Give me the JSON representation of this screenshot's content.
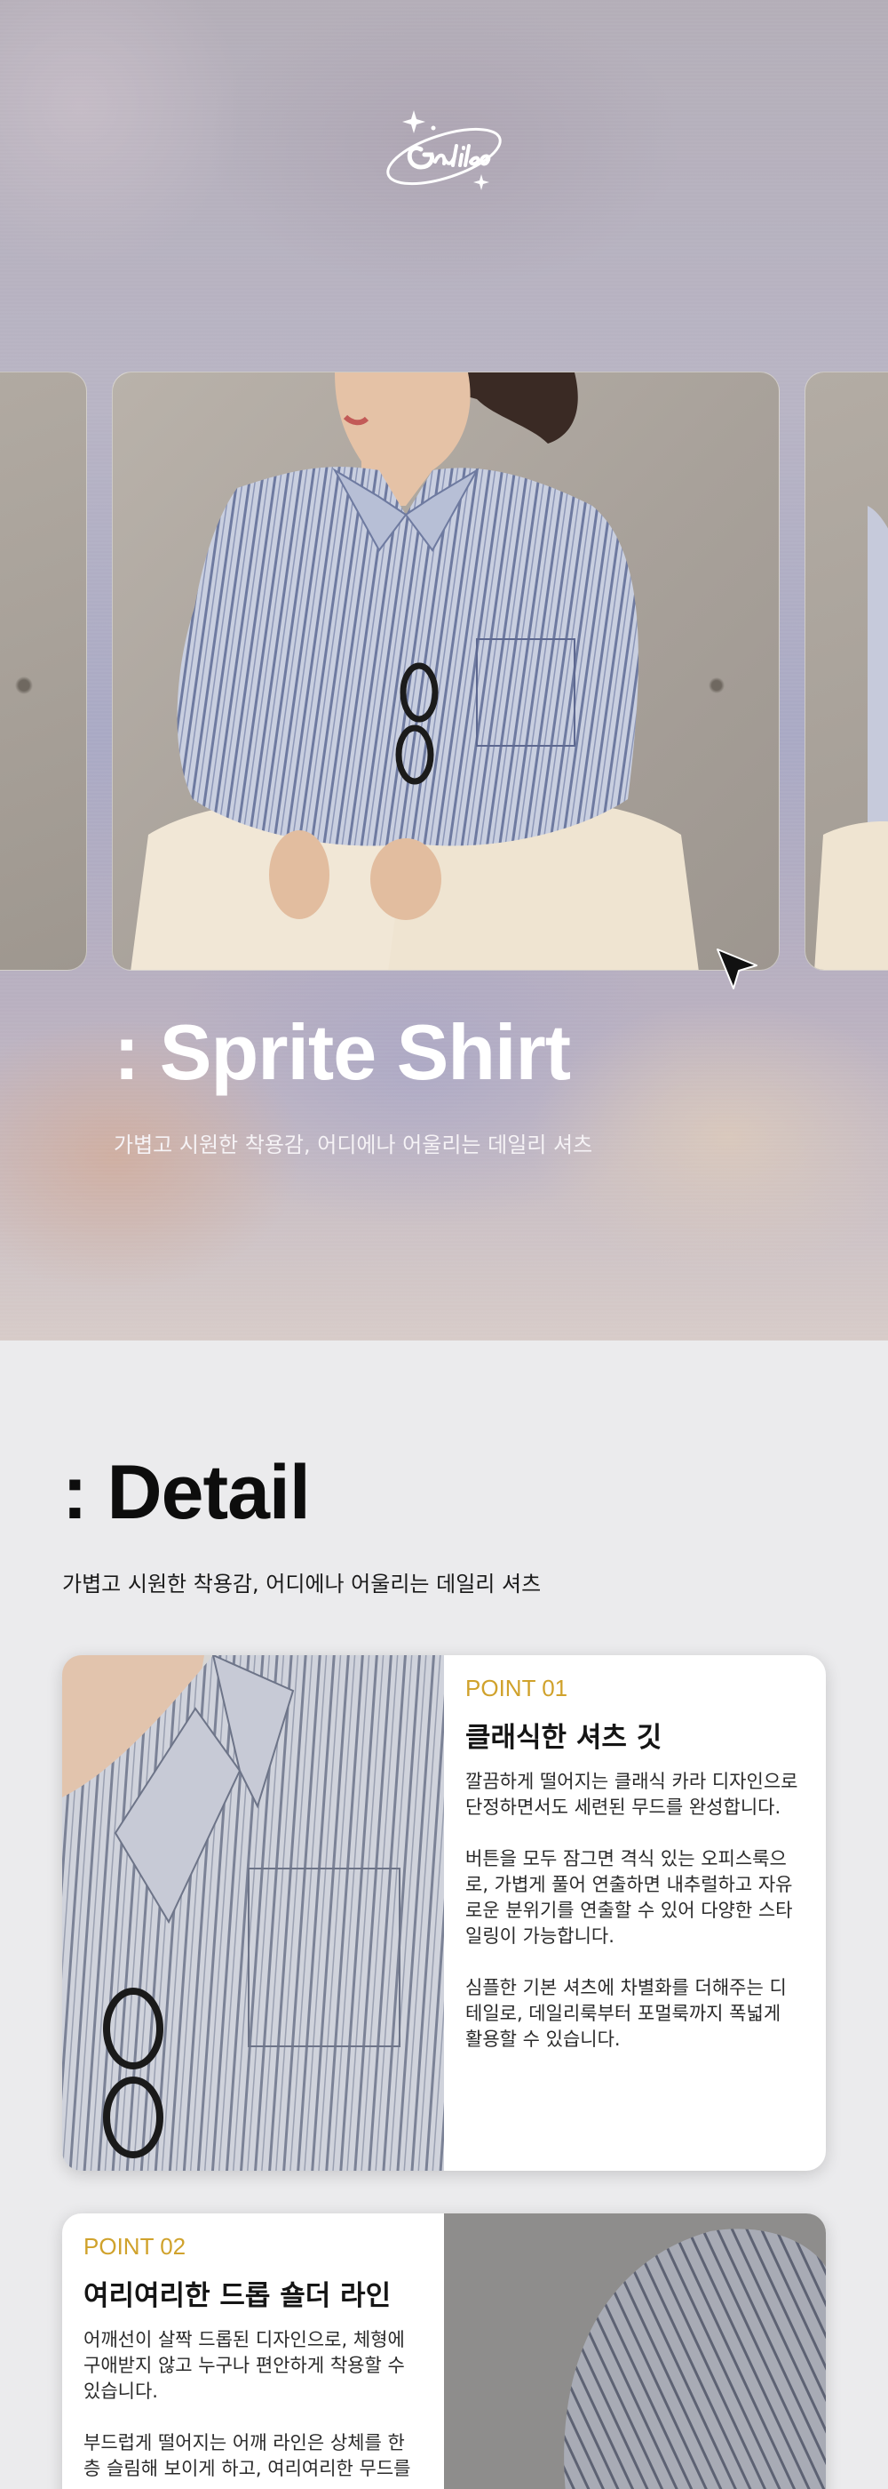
{
  "hero": {
    "brand": "Galileo",
    "title": ": Sprite Shirt",
    "subtitle": "가볍고 시원한 착용감, 어디에나 어울리는 데일리 셔츠"
  },
  "detail": {
    "title": ": Detail",
    "subtitle": "가볍고 시원한 착용감, 어디에나 어울리는 데일리 셔츠"
  },
  "points": [
    {
      "label": "POINT 01",
      "heading": "클래식한 셔츠 깃",
      "paragraphs": [
        "깔끔하게 떨어지는 클래식 카라 디자인으로 단정하면서도 세련된 무드를 완성합니다.",
        "버튼을 모두 잠그면 격식 있는 오피스룩으로, 가볍게 풀어 연출하면 내추럴하고 자유로운 분위기를 연출할 수 있어 다양한 스타일링이 가능합니다.",
        "심플한 기본 셔츠에 차별화를 더해주는 디테일로, 데일리룩부터 포멀룩까지 폭넓게 활용할 수 있습니다."
      ]
    },
    {
      "label": "POINT 02",
      "heading": "여리여리한 드롭 숄더 라인",
      "paragraphs": [
        "어깨선이 살짝 드롭된 디자인으로, 체형에 구애받지 않고 누구나 편안하게 착용할 수 있습니다.",
        "부드럽게 떨어지는 어깨 라인은 상체를 한층 슬림해 보이게 하고, 여리여리한 무드를"
      ]
    }
  ],
  "colors": {
    "accent": "#d0a22c",
    "page_bg": "#ebebed",
    "card_bg": "#ffffff",
    "shirt_stripe": "#6e7aa0"
  },
  "icons": {
    "logo": "galileo-script-logo-icon",
    "cursor": "arrow-cursor-icon"
  }
}
